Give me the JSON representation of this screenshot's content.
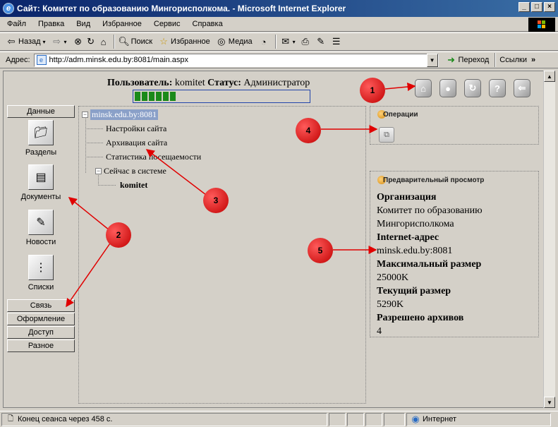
{
  "window": {
    "title": "Сайт: Комитет по образованию Мингорисполкома. - Microsoft Internet Explorer"
  },
  "menu": [
    "Файл",
    "Правка",
    "Вид",
    "Избранное",
    "Сервис",
    "Справка"
  ],
  "toolbar": {
    "back": "Назад",
    "search": "Поиск",
    "favorites": "Избранное",
    "media": "Медиа"
  },
  "address": {
    "label": "Адрес:",
    "url": "http://adm.minsk.edu.by:8081/main.aspx",
    "go": "Переход",
    "links": "Ссылки"
  },
  "header": {
    "user_label": "Пользователь:",
    "user": "komitet",
    "status_label": "Статус:",
    "status": "Администратор",
    "progress_filled": 6,
    "progress_total": 30
  },
  "nav": {
    "data": "Данные",
    "tiles": [
      {
        "label": "Разделы",
        "icon": "folder-icon"
      },
      {
        "label": "Документы",
        "icon": "documents-icon"
      },
      {
        "label": "Новости",
        "icon": "news-icon"
      },
      {
        "label": "Списки",
        "icon": "list-icon"
      }
    ],
    "buttons": [
      "Связь",
      "Оформление",
      "Доступ",
      "Разное"
    ]
  },
  "tree": {
    "root": "minsk.edu.by:8081",
    "items": [
      "Настройки сайта",
      "Архивация сайта",
      "Статистика посещаемости",
      "Сейчас в системе"
    ],
    "online_user": "komitet"
  },
  "operations": {
    "title": "Операции"
  },
  "preview": {
    "title": "Предварительный просмотр",
    "fields": [
      {
        "k": "Организация",
        "v": "Комитет по образованию"
      },
      {
        "k": "",
        "v": "Мингорисполкома"
      },
      {
        "k": "Internet-адрес",
        "v": "minsk.edu.by:8081"
      },
      {
        "k": "Максимальный размер",
        "v": "25000K"
      },
      {
        "k": "Текущий размер",
        "v": "5290K"
      },
      {
        "k": "Разрешено архивов",
        "v": "4"
      }
    ]
  },
  "markers": [
    "1",
    "2",
    "3",
    "4",
    "5"
  ],
  "status": {
    "session": "Конец сеанса через 458 с.",
    "zone": "Интернет"
  },
  "colors": {
    "titlebar": "#0a246a",
    "progress": "#1a8a1a",
    "marker": "#d00000"
  }
}
